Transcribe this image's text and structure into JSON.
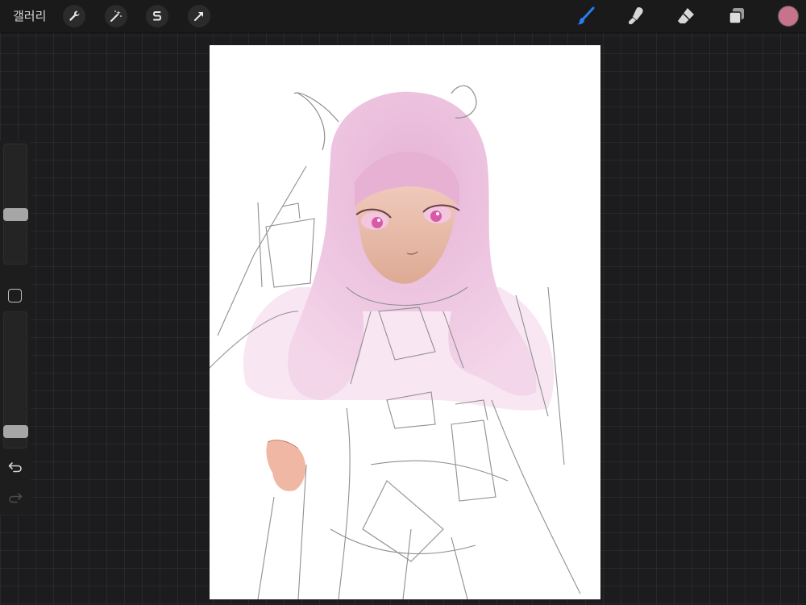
{
  "toolbar": {
    "gallery_label": "갤러리",
    "left_tools": [
      {
        "icon": "wrench-icon",
        "name": "actions"
      },
      {
        "icon": "magic-wand-icon",
        "name": "adjustments"
      },
      {
        "icon": "selection-s-icon",
        "name": "selection"
      },
      {
        "icon": "arrow-cursor-icon",
        "name": "transform"
      }
    ],
    "right_tools": [
      {
        "icon": "brush-icon",
        "name": "paint",
        "active": true
      },
      {
        "icon": "smudge-icon",
        "name": "smudge"
      },
      {
        "icon": "eraser-icon",
        "name": "eraser"
      },
      {
        "icon": "layers-icon",
        "name": "layers"
      }
    ],
    "accent_color": "#2a7cf0",
    "current_color": "#c7738c"
  },
  "sidebar": {
    "brush_size_level": 0.6,
    "opacity_level": 0.92,
    "undo_icon": "undo-icon",
    "redo_icon": "redo-icon"
  },
  "canvas": {
    "background": "#ffffff",
    "hair_color": "#e9b8d8",
    "skin_color": "#e9b7a3",
    "eye_color": "#d85aa6",
    "sketch_color": "#8f8f8f"
  }
}
